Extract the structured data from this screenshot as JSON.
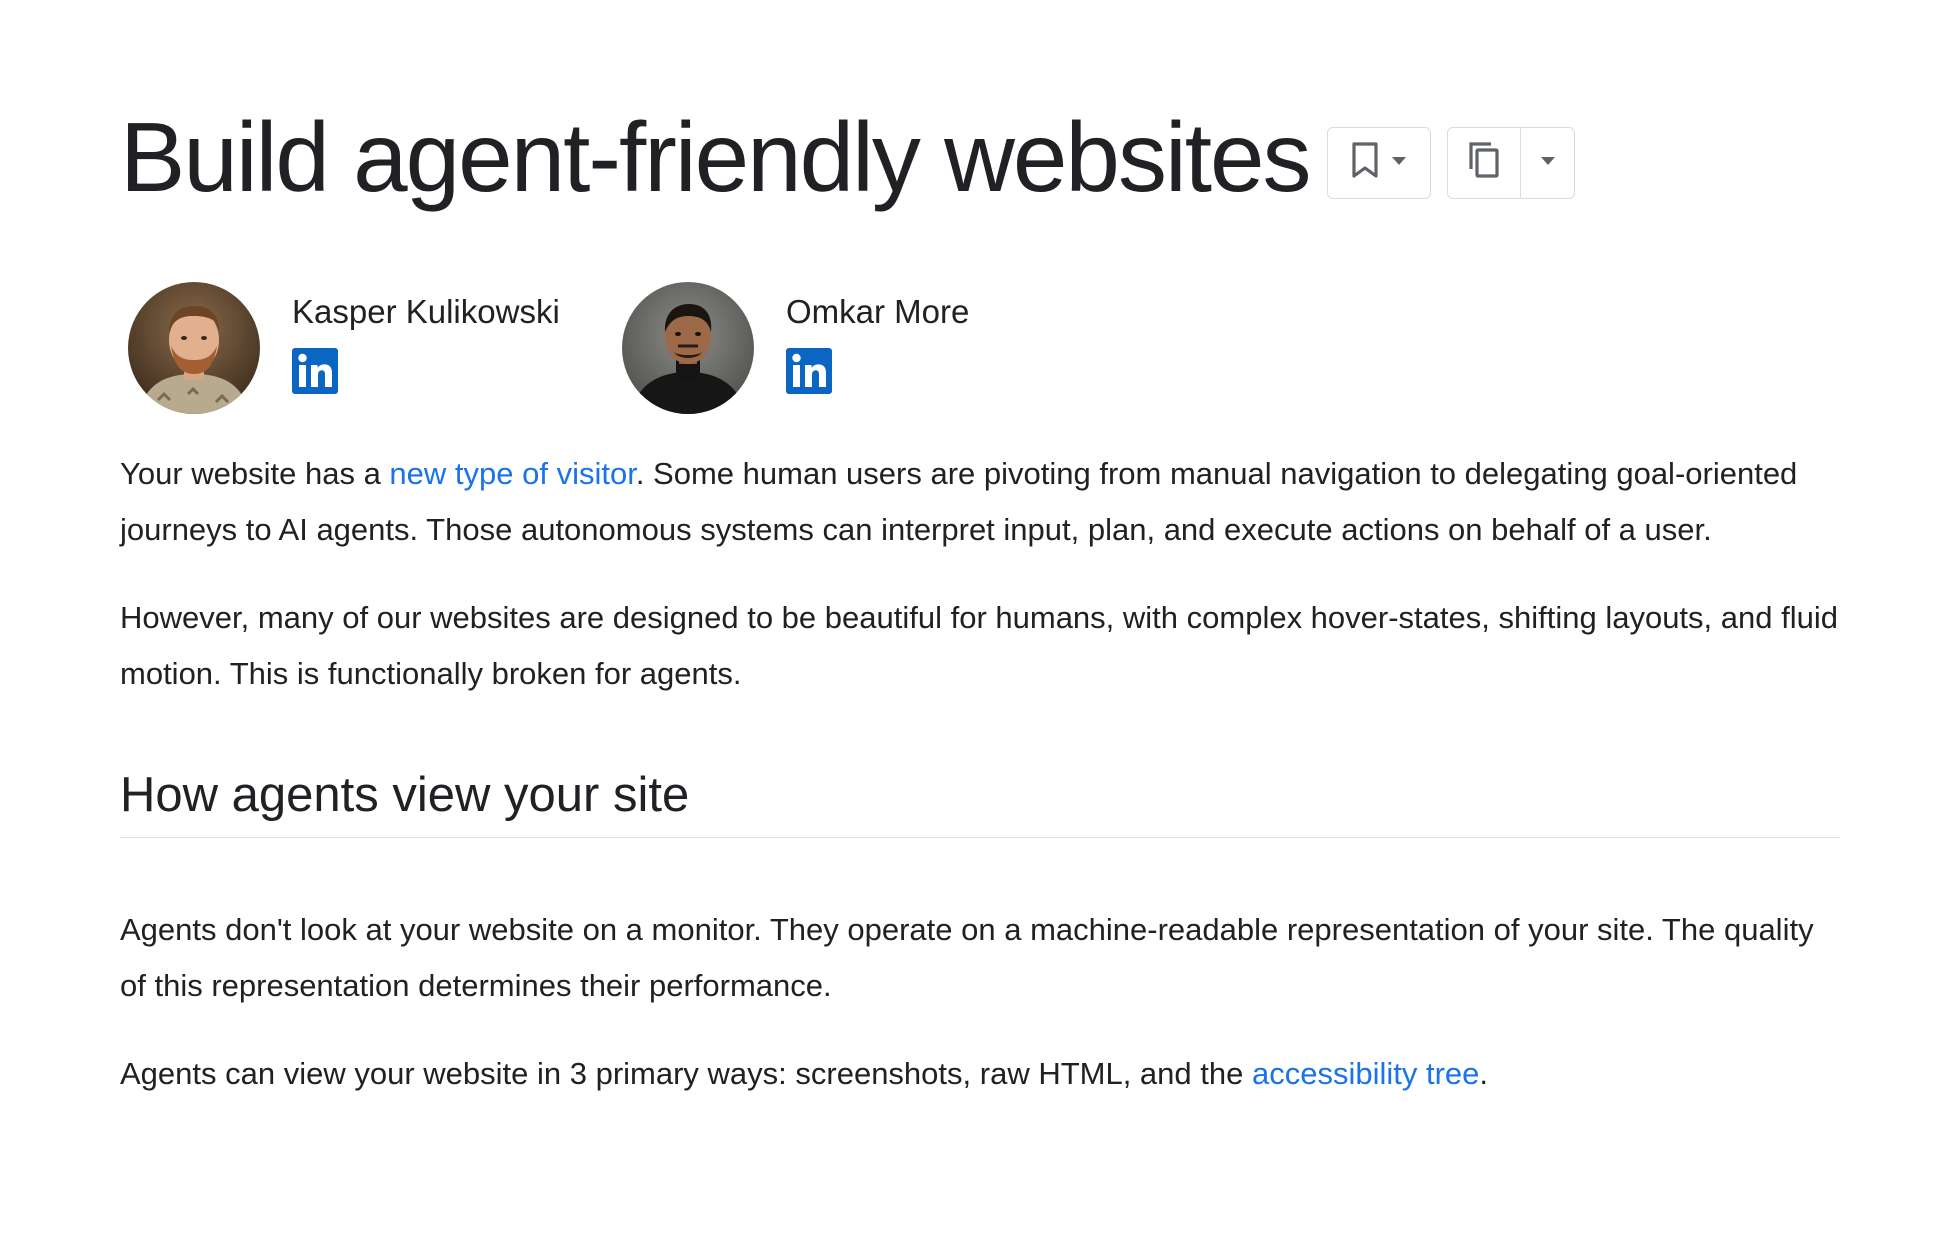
{
  "page": {
    "title": "Build agent-friendly websites"
  },
  "title_actions": {
    "bookmark_icon": "bookmark-icon",
    "dropdown_icon": "arrow-drop-down-icon",
    "copy_icon": "copy-icon"
  },
  "authors": [
    {
      "name": "Kasper Kulikowski",
      "social": "LinkedIn",
      "icon": "linkedin-icon"
    },
    {
      "name": "Omkar More",
      "social": "LinkedIn",
      "icon": "linkedin-icon"
    }
  ],
  "intro": {
    "p1_before": "Your website has a ",
    "p1_link": "new type of visitor",
    "p1_after": ". Some human users are pivoting from manual navigation to delegating goal-oriented journeys to AI agents. Those autonomous systems can interpret input, plan, and execute actions on behalf of a user.",
    "p2": "However, many of our websites are designed to be beautiful for humans, with complex hover-states, shifting layouts, and fluid motion. This is functionally broken for agents."
  },
  "section": {
    "heading": "How agents view your site",
    "p1": "Agents don't look at your website on a monitor. They operate on a machine-readable representation of your site. The quality of this representation determines their performance.",
    "p2_before": "Agents can view your website in 3 primary ways: screenshots, raw HTML, and the ",
    "p2_link": "accessibility tree",
    "p2_after": "."
  },
  "colors": {
    "link": "#1a73e8",
    "text": "#202124",
    "linkedin": "#0a66c2",
    "border": "#dadce0"
  }
}
